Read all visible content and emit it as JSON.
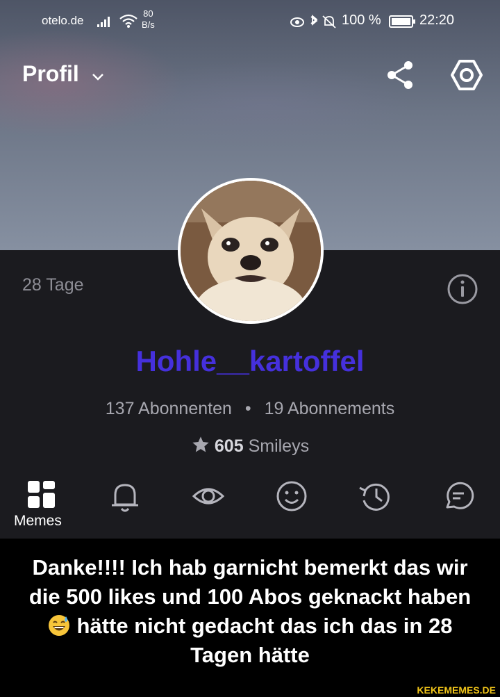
{
  "status_bar": {
    "carrier": "otelo.de",
    "rate_value": "80",
    "rate_unit": "B/s",
    "battery_percent": "100 %",
    "time": "22:20"
  },
  "header": {
    "title": "Profil"
  },
  "profile": {
    "days": "28 Tage",
    "username": "Hohle__kartoffel",
    "followers": "137 Abonnenten",
    "separator": "•",
    "following": "19 Abonnements",
    "smileys_count": "605",
    "smileys_label": "Smileys"
  },
  "tabs": [
    {
      "icon": "grid-icon",
      "label": "Memes"
    },
    {
      "icon": "bell-icon"
    },
    {
      "icon": "eye-icon"
    },
    {
      "icon": "smiley-icon"
    },
    {
      "icon": "history-icon"
    },
    {
      "icon": "comment-icon"
    }
  ],
  "caption": {
    "line1": "Danke!!!! Ich hab garnicht bemerkt das wir",
    "line2": "die 500 likes und 100 Abos geknackt haben",
    "line3": "hätte nicht gedacht das ich das in 28",
    "line4": "Tagen hätte"
  },
  "watermark": "KEKEMEMES.DE",
  "colors": {
    "username": "#4530dc",
    "background": "#1b1b1f",
    "muted_text": "#a7a7af"
  }
}
